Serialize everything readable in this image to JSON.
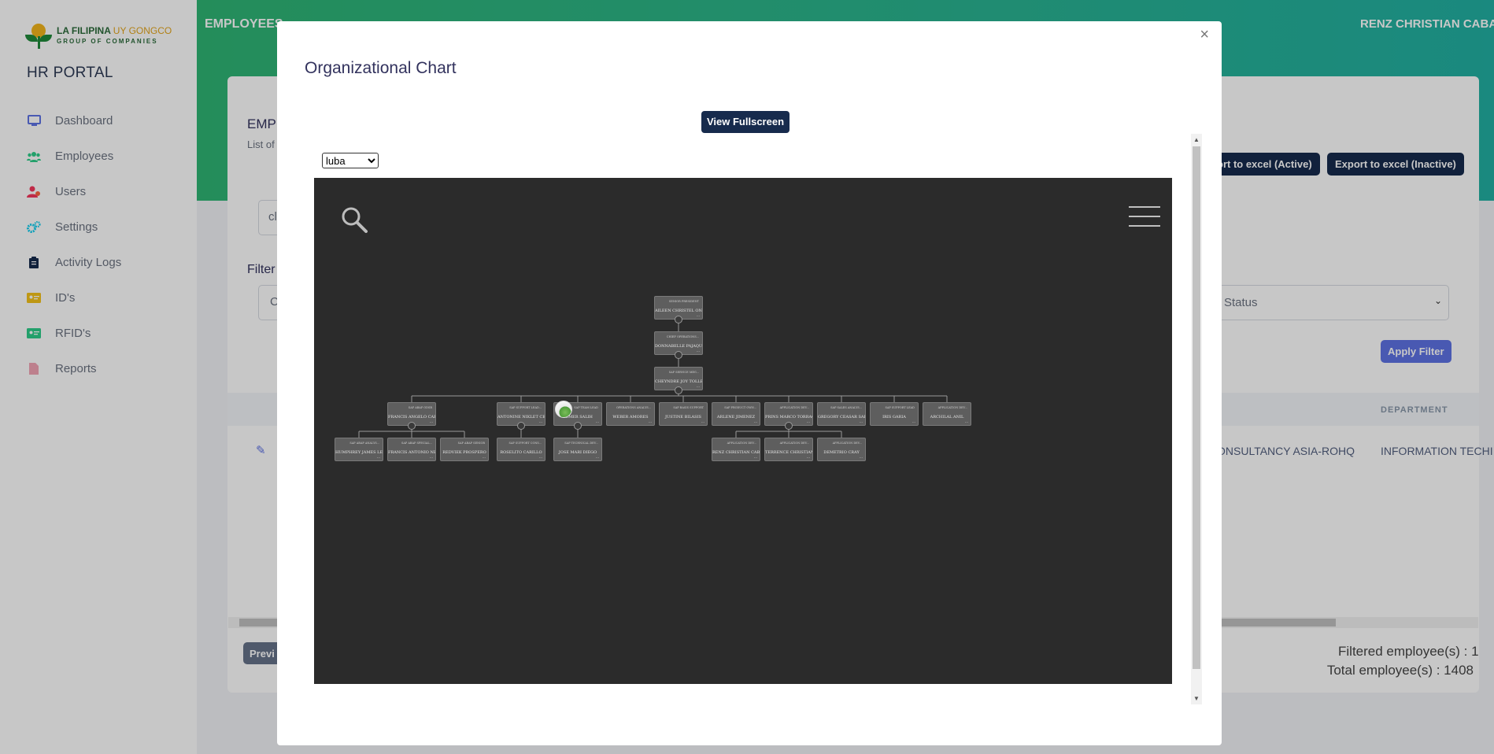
{
  "sidebar": {
    "brand_line1_a": "LA FILIPINA",
    "brand_line1_b": "UY GONGCO",
    "brand_line2": "GROUP OF COMPANIES",
    "app_title": "HR PORTAL",
    "items": [
      {
        "label": "Dashboard",
        "icon": "monitor-icon",
        "color": "#5e72e4"
      },
      {
        "label": "Employees",
        "icon": "users-icon",
        "color": "#2dce89"
      },
      {
        "label": "Users",
        "icon": "user-icon",
        "color": "#f5365c"
      },
      {
        "label": "Settings",
        "icon": "gears-icon",
        "color": "#11cdef"
      },
      {
        "label": "Activity Logs",
        "icon": "clipboard-icon",
        "color": "#172b4d"
      },
      {
        "label": "ID's",
        "icon": "id-card-icon",
        "color": "#f4c21a"
      },
      {
        "label": "RFID's",
        "icon": "id-card-icon",
        "color": "#2dce89"
      },
      {
        "label": "Reports",
        "icon": "file-icon",
        "color": "#f3a4b5"
      }
    ]
  },
  "header": {
    "title": "EMPLOYEES",
    "user": "RENZ CHRISTIAN CABATO"
  },
  "background": {
    "card_title_partial": "EMP",
    "card_subtitle_partial": "List of",
    "search_partial": "cl",
    "filter_label_partial": "Filter",
    "filter_select_partial": "C",
    "export_active_partial": "ort to excel (Active)",
    "export_inactive": "Export to excel (Inactive)",
    "status_placeholder": "Status",
    "apply_filter": "Apply Filter",
    "col_department": "DEPARTMENT",
    "row_company_partial": "ONSULTANCY ASIA-ROHQ",
    "row_department_partial": "INFORMATION TECHI",
    "prev_partial": "Previ",
    "filtered_count": "Filtered employee(s) : 1",
    "total_count": "Total employee(s) : 1408"
  },
  "modal": {
    "title": "Organizational Chart",
    "close": "×",
    "fullscreen_button": "View Fullscreen",
    "tree_select": {
      "selected": "luba",
      "options": [
        "luba"
      ]
    }
  },
  "org_chart": {
    "colors": {
      "background": "#2b2b2b",
      "node": "#5e5e5e",
      "link": "#9a9a9a"
    },
    "nodes": [
      {
        "id": "n1",
        "name": "AILEEN CHRISTEL ONGK...",
        "title": "SENIOR PRESIDENT"
      },
      {
        "id": "n2",
        "name": "DONNABELLE PAJAQUIN",
        "title": "CHIEF OPERATIONS..."
      },
      {
        "id": "n3",
        "name": "CHEYNDRE JOY TOLLEDO",
        "title": "SAP SERVICE MEG..."
      },
      {
        "id": "n4",
        "name": "FRANCIS ANGELO CARINO",
        "title": "SAP ABAP ODSR"
      },
      {
        "id": "n5",
        "name": "ANTONINE NIKLET CERRO",
        "title": "SAP SUPPORT LEAD..."
      },
      {
        "id": "n6",
        "name": "ELMER SALIH",
        "title": "SAP TEAM LEAD",
        "avatar": true
      },
      {
        "id": "n7",
        "name": "WEBER AMORES",
        "title": "OPERATIONS ANALYS..."
      },
      {
        "id": "n8",
        "name": "JUSTINE BILASIS",
        "title": "SAP BASIS SUPPORT"
      },
      {
        "id": "n9",
        "name": "ARLENE JIMENEZ",
        "title": "SAP PRODUCT OWN..."
      },
      {
        "id": "n10",
        "name": "PRINS MARCO TORRAQUITE",
        "title": "APPLICATION DEV..."
      },
      {
        "id": "n11",
        "name": "GREGORY CEASAR SARM...",
        "title": "SAP SALES ANALYS..."
      },
      {
        "id": "n12",
        "name": "IRIS GARIA",
        "title": "SAP SUPPORT LEAD"
      },
      {
        "id": "n13",
        "name": "ARCHILAL ANIL",
        "title": "APPLICATION DEV..."
      },
      {
        "id": "n14",
        "name": "HUMPHREY JAMES LEGUN...",
        "title": "SAP ABAP ANALYS..."
      },
      {
        "id": "n15",
        "name": "FRANCIS ANTONIO NERI...",
        "title": "SAP ABAP SPECIAL..."
      },
      {
        "id": "n16",
        "name": "REDVIEK PROSPERO",
        "title": "SAP ABAP SENIOR"
      },
      {
        "id": "n17",
        "name": "ROSELITO CARILLO",
        "title": "SAP SUPPORT CONS..."
      },
      {
        "id": "n18",
        "name": "JOSE MARI DIEGO",
        "title": "SAP TECHNICAL DEV..."
      },
      {
        "id": "n19",
        "name": "RENZ CHRISTIAN CABATO",
        "title": "APPLICATION DEV..."
      },
      {
        "id": "n20",
        "name": "TERRENCE CHRISTIAN TE...",
        "title": "APPLICATION DEV..."
      },
      {
        "id": "n21",
        "name": "DEMETRIO CRAY",
        "title": "APPLICATION DEV..."
      }
    ]
  }
}
